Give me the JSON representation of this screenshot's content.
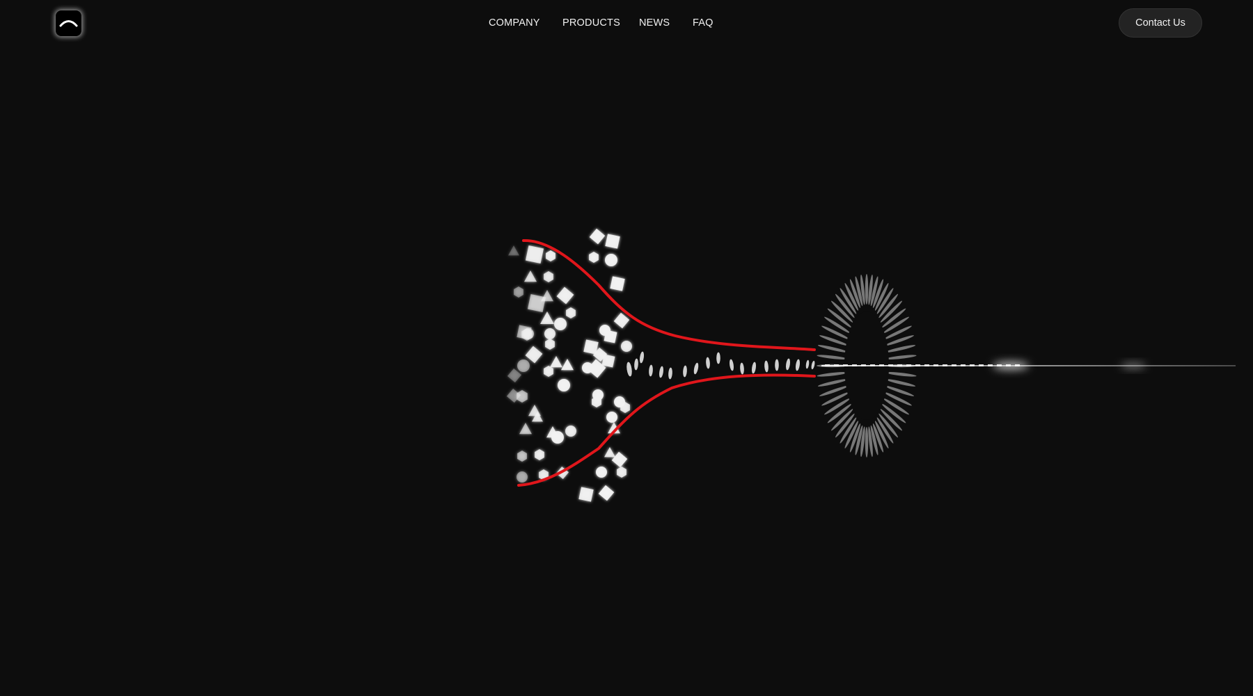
{
  "nav": {
    "items": [
      {
        "label": "COMPANY"
      },
      {
        "label": "PRODUCTS"
      },
      {
        "label": "NEWS"
      },
      {
        "label": "FAQ"
      }
    ],
    "contact_label": "Contact Us"
  },
  "icons": {
    "logo": "arc-logo-icon"
  },
  "colors": {
    "background": "#0d0d0d",
    "accent_curve": "#e0161b",
    "particle": "#f2f2f2",
    "button_bg": "#232323"
  }
}
